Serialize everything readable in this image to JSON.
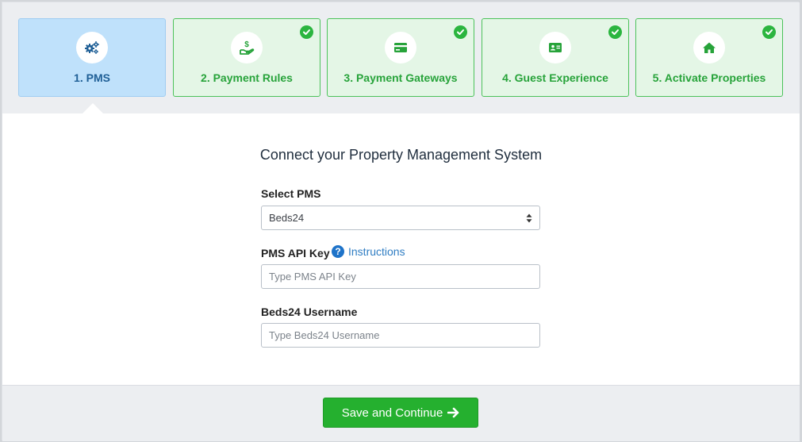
{
  "steps": [
    {
      "label": "1. PMS",
      "icon": "gears-icon",
      "state": "active"
    },
    {
      "label": "2. Payment Rules",
      "icon": "hand-dollar-icon",
      "state": "done"
    },
    {
      "label": "3. Payment Gateways",
      "icon": "credit-card-icon",
      "state": "done"
    },
    {
      "label": "4. Guest Experience",
      "icon": "id-card-icon",
      "state": "done"
    },
    {
      "label": "5. Activate Properties",
      "icon": "home-icon",
      "state": "done"
    }
  ],
  "main": {
    "title": "Connect your Property Management System",
    "select_pms": {
      "label": "Select PMS",
      "value": "Beds24"
    },
    "api_key": {
      "label": "PMS API Key",
      "help_link": "Instructions",
      "placeholder": "Type PMS API Key"
    },
    "username": {
      "label": "Beds24 Username",
      "placeholder": "Type Beds24 Username"
    }
  },
  "footer": {
    "save_label": "Save and Continue"
  },
  "colors": {
    "active_step_bg": "#bfe1fb",
    "done_step_bg": "#e4f6e6",
    "accent_green": "#25b02f",
    "link_blue": "#2f7dc3"
  }
}
